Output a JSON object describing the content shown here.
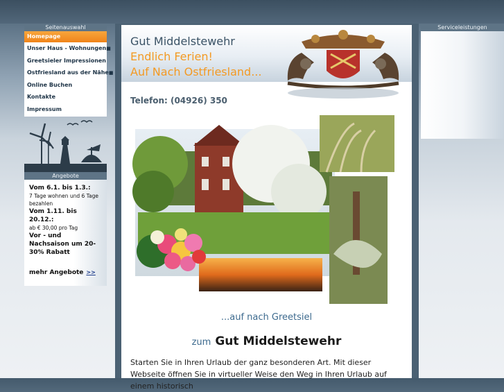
{
  "sidebar": {
    "heading": "Seitenauswahl",
    "items": [
      {
        "label": "Homepage",
        "active": true,
        "dot": ""
      },
      {
        "label": "Unser Haus - Wohnungen",
        "active": false,
        "dot": "■"
      },
      {
        "label": "Greetsieler Impressionen",
        "active": false,
        "dot": ""
      },
      {
        "label": "Ostfriesland aus der Nähe",
        "active": false,
        "dot": "■"
      },
      {
        "label": "Online Buchen",
        "active": false,
        "dot": ""
      },
      {
        "label": "Kontakte",
        "active": false,
        "dot": ""
      },
      {
        "label": "Impressum",
        "active": false,
        "dot": ""
      }
    ]
  },
  "offers": {
    "heading": "Angebote",
    "line1": "Vom 6.1. bis 1.3.:",
    "line2": "7 Tage wohnen und 6 Tage bezahlen",
    "line3": "Vom 1.11. bis 20.12.:",
    "line4": "ab € 30,00 pro Tag",
    "line5": "Vor - und Nachsaison um 20-30% Rabatt",
    "more_label": "mehr Angebote",
    "more_link": ">>"
  },
  "header": {
    "title": "Gut Middelstewehr",
    "subtitle1": "Endlich Ferien!",
    "subtitle2": "Auf Nach Ostfriesland..."
  },
  "main": {
    "phone": "Telefon: (04926) 350",
    "caption": "...auf nach Greetsiel",
    "zum": "zum",
    "brand": "Gut Middelstewehr",
    "intro": "Starten Sie in Ihren Urlaub der ganz besonderen Art. Mit dieser Webseite öffnen Sie in virtueller Weise den Weg in Ihren Urlaub auf einem historisch"
  },
  "right": {
    "heading": "Serviceleistungen"
  },
  "colors": {
    "accent": "#f39a24",
    "panel": "#5e7486",
    "link": "#1d3b8a"
  }
}
